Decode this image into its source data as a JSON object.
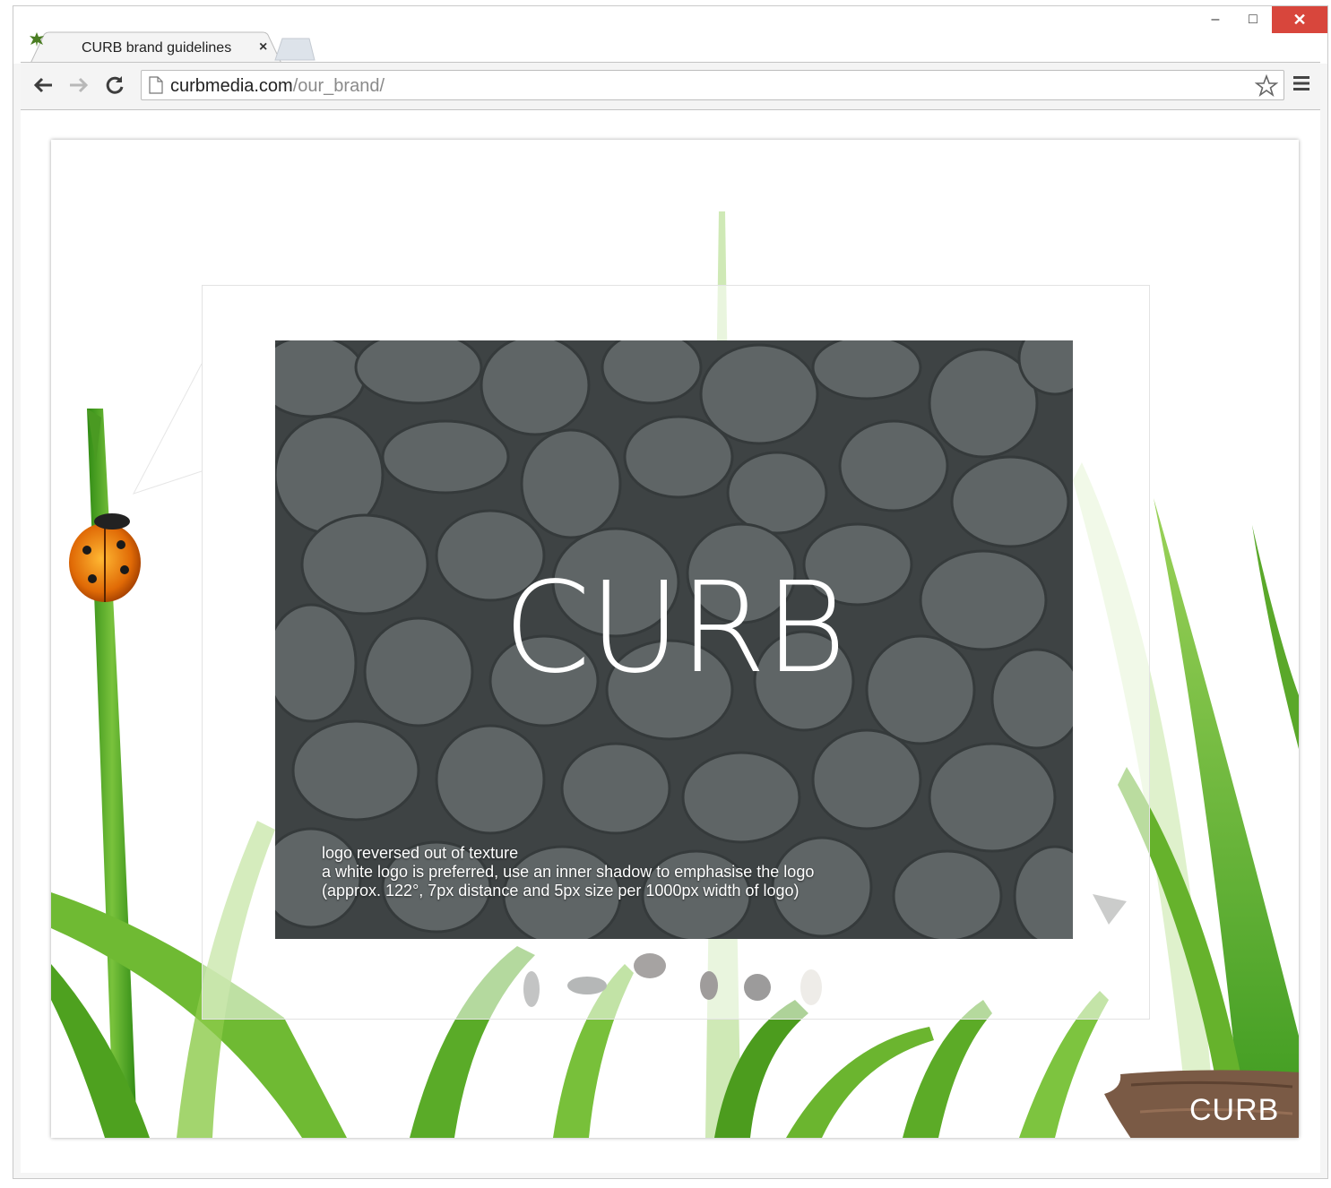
{
  "browser": {
    "tab": {
      "title": "CURB brand guidelines",
      "close_glyph": "×",
      "icon": "leaf-icon"
    },
    "window_controls": {
      "minimize": "‒",
      "maximize": "□",
      "close": "✕"
    },
    "address": {
      "host": "curbmedia.com",
      "path": "/our_brand/"
    },
    "icons": [
      "back-icon",
      "forward-icon",
      "reload-icon",
      "page-icon",
      "star-icon",
      "menu-icon"
    ]
  },
  "page": {
    "logo_text": "CURB",
    "caption_lines": [
      "logo reversed out of texture",
      "a white logo is preferred, use an inner shadow to emphasise the logo",
      "(approx. 122°, 7px distance and 5px size per 1000px width of logo)"
    ],
    "badge_text": "CURB",
    "colors": {
      "grass": "#5fae2e",
      "stone": "#4c5253",
      "badge_wood": "#7a5a45",
      "close_red": "#d8463c"
    }
  }
}
